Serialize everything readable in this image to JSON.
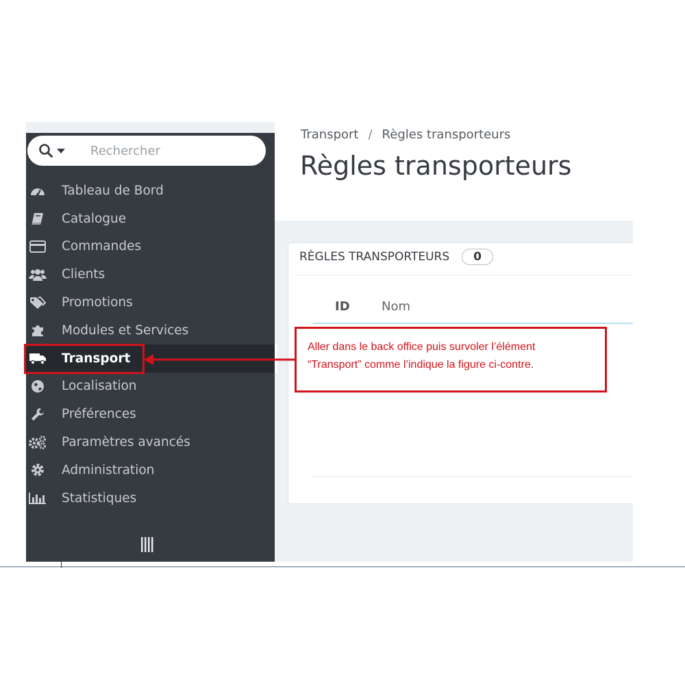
{
  "search": {
    "placeholder": "Rechercher"
  },
  "sidebar": {
    "items": [
      {
        "label": "Tableau de Bord",
        "icon": "dashboard-icon"
      },
      {
        "label": "Catalogue",
        "icon": "book-icon"
      },
      {
        "label": "Commandes",
        "icon": "credit-card-icon"
      },
      {
        "label": "Clients",
        "icon": "users-icon"
      },
      {
        "label": "Promotions",
        "icon": "tags-icon"
      },
      {
        "label": "Modules et Services",
        "icon": "puzzle-icon"
      },
      {
        "label": "Transport",
        "icon": "truck-icon",
        "active": true
      },
      {
        "label": "Localisation",
        "icon": "globe-icon"
      },
      {
        "label": "Préférences",
        "icon": "wrench-icon"
      },
      {
        "label": "Paramètres avancés",
        "icon": "cogs-icon"
      },
      {
        "label": "Administration",
        "icon": "gear-icon"
      },
      {
        "label": "Statistiques",
        "icon": "bar-chart-icon"
      }
    ]
  },
  "breadcrumb": {
    "parent": "Transport",
    "separator": "/",
    "current": "Règles transporteurs"
  },
  "page": {
    "title": "Règles transporteurs"
  },
  "panel": {
    "heading": "RÈGLES TRANSPORTEURS",
    "count": "0",
    "columns": {
      "id": "ID",
      "name": "Nom"
    }
  },
  "annotation": {
    "line1": "Aller dans le back office  puis survoler l’élément",
    "line2": "“Transport” comme l’indique la figure ci-contre."
  },
  "colors": {
    "sidebar_bg": "#363a41",
    "sidebar_active_bg": "#25282d",
    "annotation_red": "#d0141c",
    "table_header_line": "#b3e1ec"
  }
}
